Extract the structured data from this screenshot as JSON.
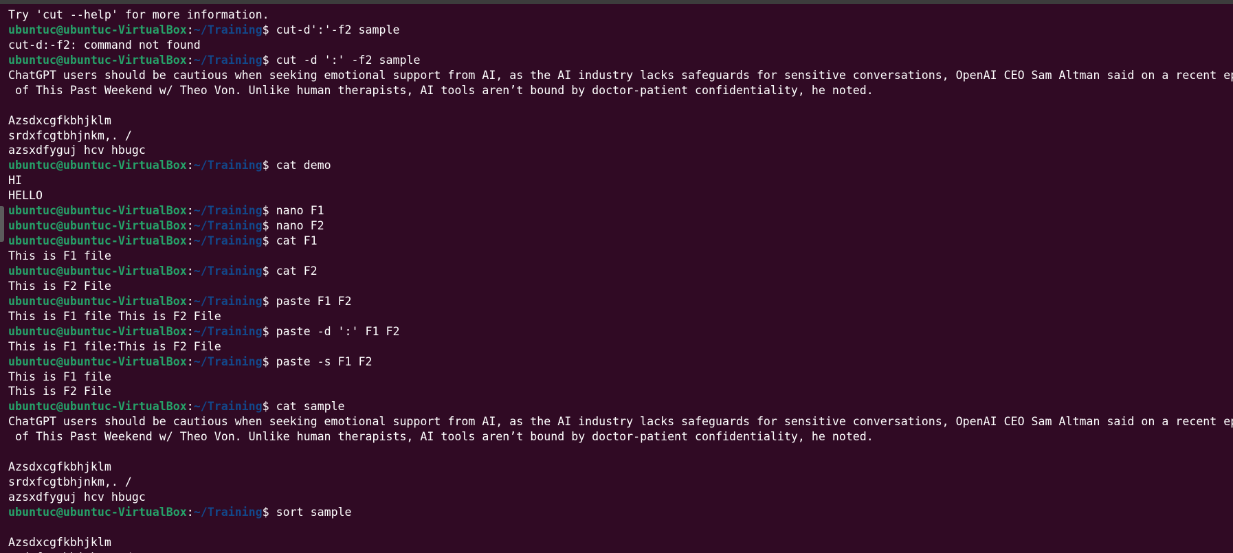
{
  "terminal": {
    "prompt": {
      "user_host": "ubuntuc@ubuntuc-VirtualBox",
      "colon": ":",
      "path": "~/Training",
      "dollar": "$ "
    },
    "lines": [
      {
        "type": "output",
        "text": "Try 'cut --help' for more information."
      },
      {
        "type": "prompt",
        "cmd": "cut-d':'-f2 sample"
      },
      {
        "type": "output",
        "text": "cut-d:-f2: command not found"
      },
      {
        "type": "prompt",
        "cmd": "cut -d ':' -f2 sample"
      },
      {
        "type": "output",
        "text": "ChatGPT users should be cautious when seeking emotional support from AI, as the AI industry lacks safeguards for sensitive conversations, OpenAI CEO Sam Altman said on a recent ep"
      },
      {
        "type": "output",
        "text": " of This Past Weekend w/ Theo Von. Unlike human therapists, AI tools aren’t bound by doctor-patient confidentiality, he noted."
      },
      {
        "type": "output",
        "text": ""
      },
      {
        "type": "output",
        "text": "Azsdxcgfkbhjklm"
      },
      {
        "type": "output",
        "text": "srdxfcgtbhjnkm,. /"
      },
      {
        "type": "output",
        "text": "azsxdfyguj hcv hbugc"
      },
      {
        "type": "prompt",
        "cmd": "cat demo"
      },
      {
        "type": "output",
        "text": "HI"
      },
      {
        "type": "output",
        "text": "HELLO"
      },
      {
        "type": "prompt",
        "cmd": "nano F1"
      },
      {
        "type": "prompt",
        "cmd": "nano F2"
      },
      {
        "type": "prompt",
        "cmd": "cat F1"
      },
      {
        "type": "output",
        "text": "This is F1 file"
      },
      {
        "type": "prompt",
        "cmd": "cat F2"
      },
      {
        "type": "output",
        "text": "This is F2 File"
      },
      {
        "type": "prompt",
        "cmd": "paste F1 F2"
      },
      {
        "type": "output",
        "text": "This is F1 file This is F2 File"
      },
      {
        "type": "prompt",
        "cmd": "paste -d ':' F1 F2"
      },
      {
        "type": "output",
        "text": "This is F1 file:This is F2 File"
      },
      {
        "type": "prompt",
        "cmd": "paste -s F1 F2"
      },
      {
        "type": "output",
        "text": "This is F1 file"
      },
      {
        "type": "output",
        "text": "This is F2 File"
      },
      {
        "type": "prompt",
        "cmd": "cat sample"
      },
      {
        "type": "output",
        "text": "ChatGPT users should be cautious when seeking emotional support from AI, as the AI industry lacks safeguards for sensitive conversations, OpenAI CEO Sam Altman said on a recent ep"
      },
      {
        "type": "output",
        "text": " of This Past Weekend w/ Theo Von. Unlike human therapists, AI tools aren’t bound by doctor-patient confidentiality, he noted."
      },
      {
        "type": "output",
        "text": ""
      },
      {
        "type": "output",
        "text": "Azsdxcgfkbhjklm"
      },
      {
        "type": "output",
        "text": "srdxfcgtbhjnkm,. /"
      },
      {
        "type": "output",
        "text": "azsxdfyguj hcv hbugc"
      },
      {
        "type": "prompt",
        "cmd": "sort sample"
      },
      {
        "type": "output",
        "text": ""
      },
      {
        "type": "output",
        "text": "Azsdxcgfkbhjklm"
      },
      {
        "type": "output",
        "text": "srdxfcgtbhjnkm,. /"
      }
    ]
  }
}
